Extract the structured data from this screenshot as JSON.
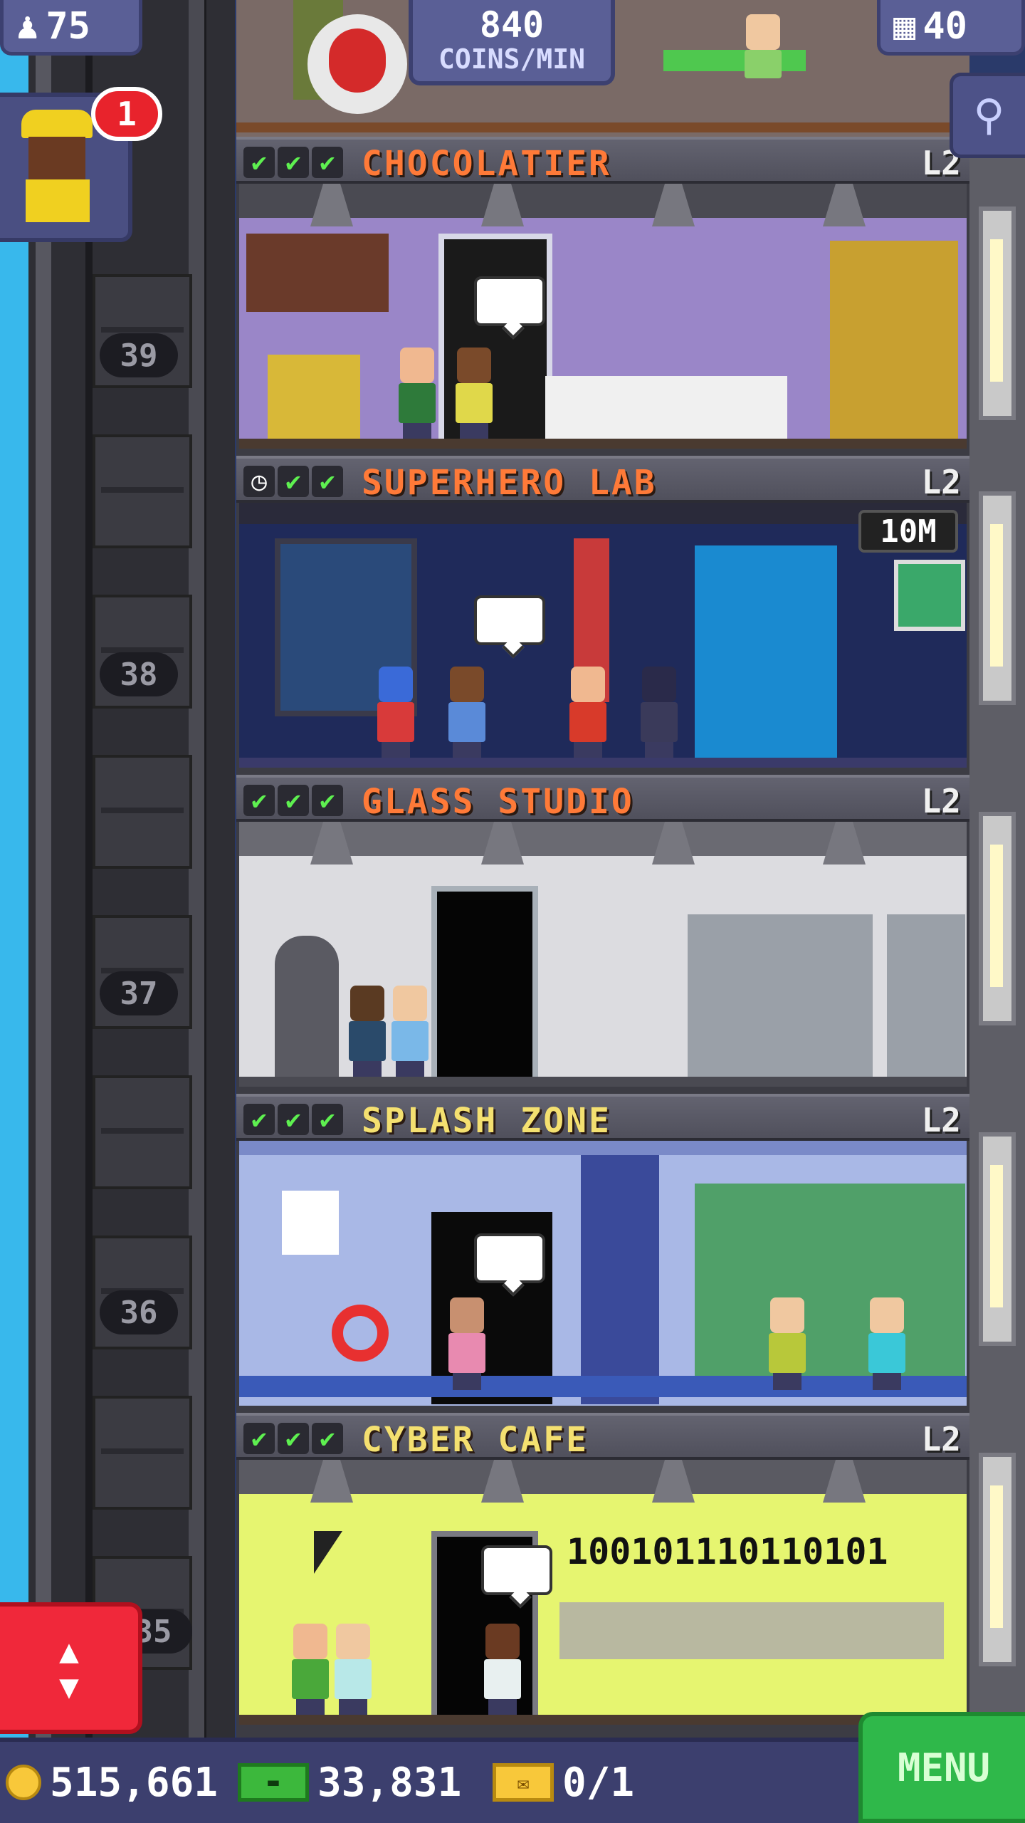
{
  "hud": {
    "population": "75",
    "coins_per_min": "840",
    "coins_per_min_label": "COINS/MIN",
    "floors_count": "40",
    "visitor_badge": "1",
    "search_icon": "magnifier-icon",
    "elevator_icon": "up-down-arrows-icon"
  },
  "elevator_floors": [
    {
      "num": "39"
    },
    {
      "num": "38"
    },
    {
      "num": "37"
    },
    {
      "num": "36"
    },
    {
      "num": "35"
    }
  ],
  "floors": [
    {
      "name": "CHOCOLATIER",
      "level": "L2",
      "status": [
        "check",
        "check",
        "check"
      ],
      "room_color": "#9a86c8"
    },
    {
      "name": "SUPERHERO LAB",
      "level": "L2",
      "status": [
        "clock",
        "check",
        "check"
      ],
      "timer": "10M",
      "room_color": "#1f2a5a"
    },
    {
      "name": "GLASS STUDIO",
      "level": "L2",
      "status": [
        "check",
        "check",
        "check"
      ],
      "room_color": "#dcdce0"
    },
    {
      "name": "SPLASH ZONE",
      "level": "L2",
      "status": [
        "check",
        "check",
        "check"
      ],
      "room_color": "#a9b8e6"
    },
    {
      "name": "CYBER CAFE",
      "level": "L2",
      "status": [
        "check",
        "check",
        "check"
      ],
      "room_color": "#e6f570",
      "screen_text": "100101110110101"
    }
  ],
  "bottom": {
    "coins": "515,661",
    "bux": "33,831",
    "tickets": "0/1",
    "menu_label": "MENU"
  },
  "colors": {
    "title_orange": "#ff7a38",
    "title_yellow": "#f4e070",
    "check_green": "#5ef050",
    "menu_green": "#2fb84a",
    "elevator_red": "#f0283a",
    "hud_blue": "#5a5f96"
  }
}
